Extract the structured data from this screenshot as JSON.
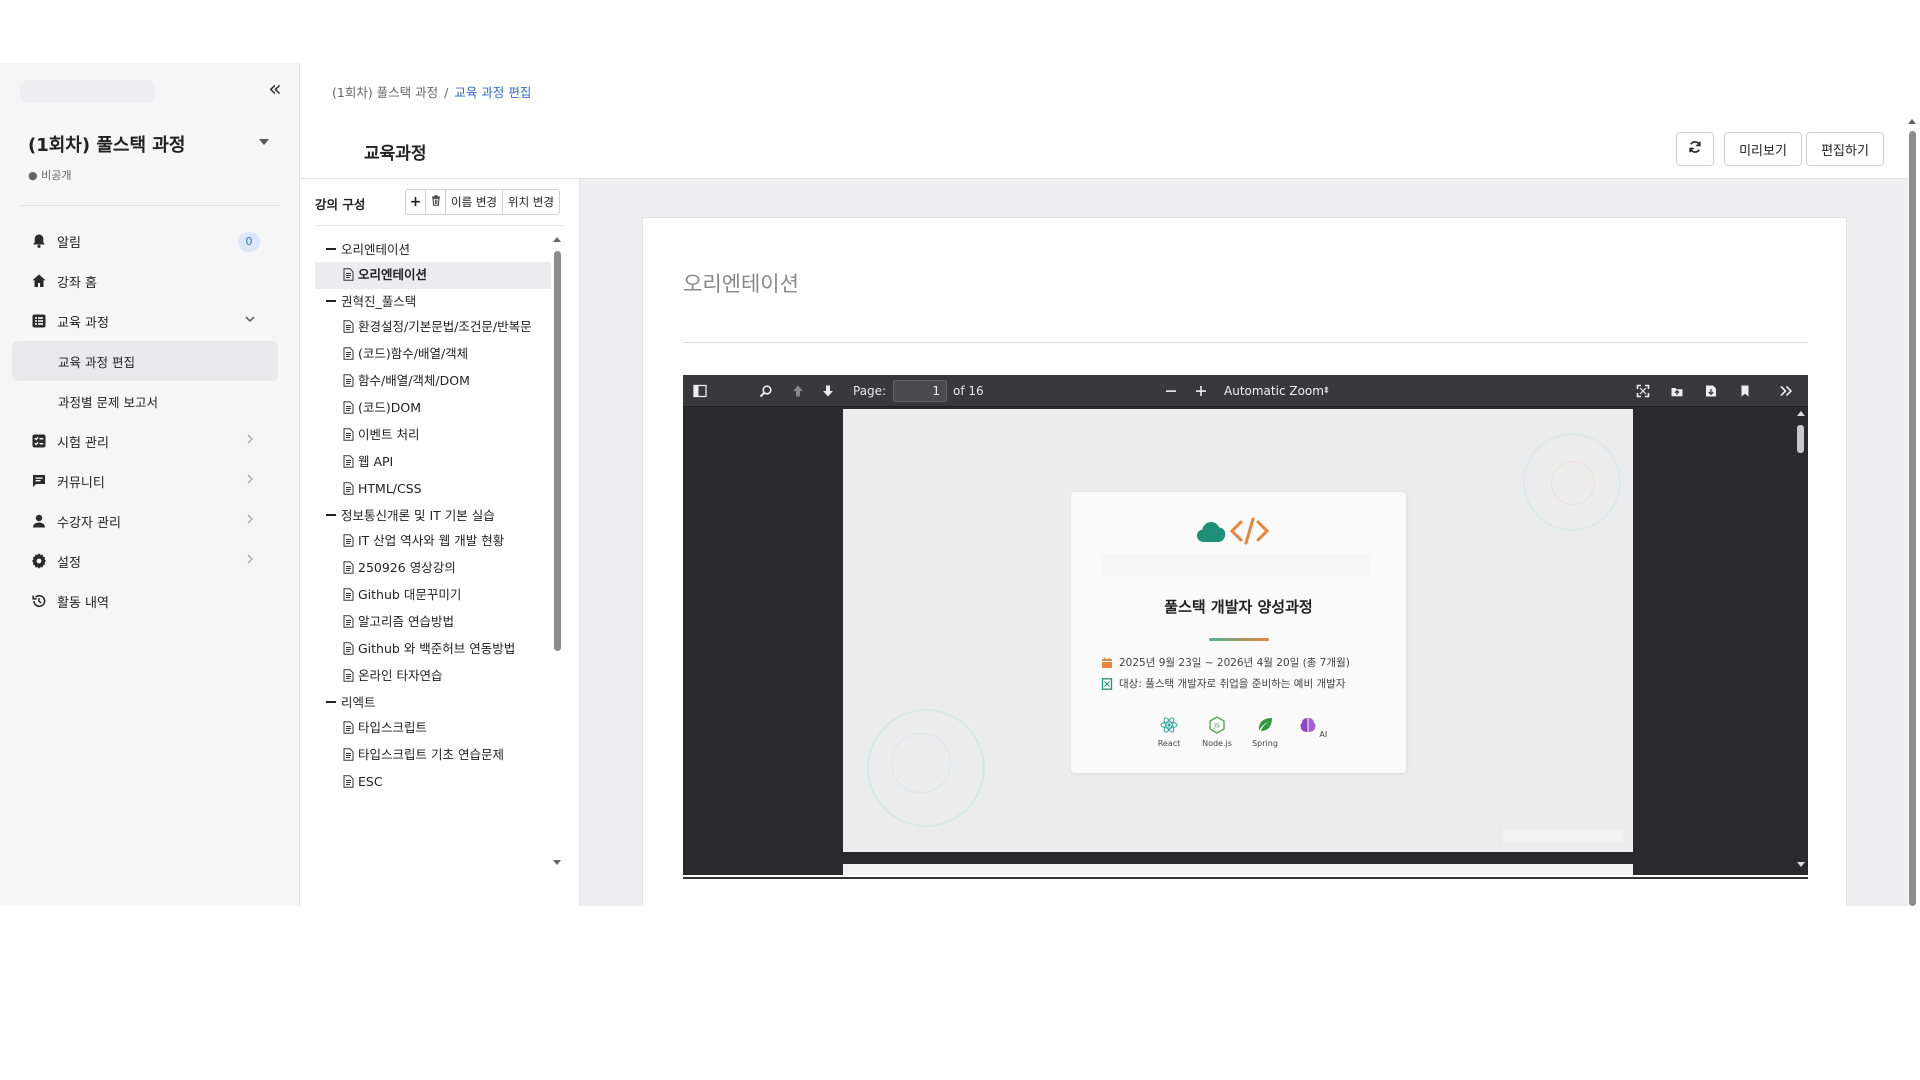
{
  "sidebar": {
    "course_title": "(1회차) 풀스택 과정",
    "visibility": "● 비공개",
    "nav": [
      {
        "label": "알림",
        "icon": "bell-icon",
        "badge": "0"
      },
      {
        "label": "강좌 홈",
        "icon": "home-icon"
      },
      {
        "label": "교육 과정",
        "icon": "list-icon",
        "expanded": true
      },
      {
        "label": "교육 과정 편집",
        "sub": true,
        "active": true
      },
      {
        "label": "과정별 문제 보고서",
        "sub": true
      },
      {
        "label": "시험 관리",
        "icon": "checklist-icon"
      },
      {
        "label": "커뮤니티",
        "icon": "chat-icon"
      },
      {
        "label": "수강자 관리",
        "icon": "user-icon"
      },
      {
        "label": "설정",
        "icon": "gear-icon"
      },
      {
        "label": "활동 내역",
        "icon": "history-icon"
      }
    ]
  },
  "breadcrumb": {
    "parent": "(1회차) 풀스택 과정",
    "separator": "/",
    "current": "교육 과정 편집"
  },
  "header": {
    "title": "교육과정",
    "preview_label": "미리보기",
    "edit_label": "편집하기"
  },
  "tree": {
    "heading": "강의 구성",
    "tools": {
      "add": "+",
      "rename": "이름 변경",
      "move": "위치 변경"
    },
    "items": [
      {
        "type": "section",
        "label": "오리엔테이션"
      },
      {
        "type": "leaf",
        "label": "오리엔테이션",
        "active": true
      },
      {
        "type": "section",
        "label": "권혁진_풀스택"
      },
      {
        "type": "leaf",
        "label": "환경설정/기본문법/조건문/반복문"
      },
      {
        "type": "leaf",
        "label": "(코드)함수/배열/객체"
      },
      {
        "type": "leaf",
        "label": "함수/배열/객체/DOM"
      },
      {
        "type": "leaf",
        "label": "(코드)DOM"
      },
      {
        "type": "leaf",
        "label": "이벤트 처리"
      },
      {
        "type": "leaf",
        "label": "웹 API"
      },
      {
        "type": "leaf",
        "label": "HTML/CSS"
      },
      {
        "type": "section",
        "label": "정보통신개론 및 IT 기본 실습"
      },
      {
        "type": "leaf",
        "label": "IT 산업 역사와 웹 개발 현황"
      },
      {
        "type": "leaf",
        "label": "250926 영상강의"
      },
      {
        "type": "leaf",
        "label": "Github 대문꾸미기"
      },
      {
        "type": "leaf",
        "label": "알고리즘 연습방법"
      },
      {
        "type": "leaf",
        "label": "Github 와 백준허브 연동방법"
      },
      {
        "type": "leaf",
        "label": "온라인 타자연습"
      },
      {
        "type": "section",
        "label": "리엑트"
      },
      {
        "type": "leaf",
        "label": "타입스크립트"
      },
      {
        "type": "leaf",
        "label": "타입스크립트 기초 연습문제"
      },
      {
        "type": "leaf",
        "label": "ESC"
      }
    ]
  },
  "content": {
    "title": "오리엔테이션"
  },
  "pdf": {
    "page_label": "Page:",
    "page_value": "1",
    "page_total": "of 16",
    "zoom": "Automatic Zoom",
    "slide": {
      "title": "풀스택 개발자 양성과정",
      "date_line": "2025년 9월 23일 ~ 2026년 4월 20일 (총 7개월)",
      "target_line": "대상: 풀스택 개발자로 취업을 준비하는 예비 개발자",
      "techs": [
        "React",
        "Node.js",
        "Spring",
        "AI"
      ]
    }
  },
  "colors": {
    "accent": "#2f6cd0",
    "badge_bg": "#dde7fb",
    "logo_teal": "#1f8f7a",
    "logo_orange": "#e8843b",
    "pdf_toolbar": "#38383d"
  }
}
